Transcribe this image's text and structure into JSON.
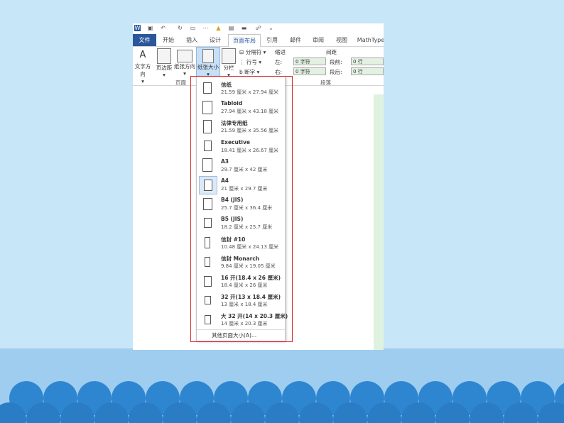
{
  "qat": {
    "icons": [
      "word-logo-icon",
      "save-icon",
      "undo-icon",
      "redo-icon",
      "new-doc-icon",
      "customize-icon",
      "warning-icon",
      "picture-icon",
      "equation-icon",
      "org-chart-icon",
      "more-icon"
    ]
  },
  "tabs": [
    {
      "label": "文件"
    },
    {
      "label": "开始"
    },
    {
      "label": "插入"
    },
    {
      "label": "设计"
    },
    {
      "label": "页面布局"
    },
    {
      "label": "引用"
    },
    {
      "label": "邮件"
    },
    {
      "label": "审阅"
    },
    {
      "label": "视图"
    },
    {
      "label": "MathType"
    }
  ],
  "ribbon": {
    "text_direction": "文字方向",
    "margins": "页边距",
    "orientation": "纸张方向",
    "size": "纸张大小",
    "columns": "分栏",
    "breaks": "分隔符",
    "line_numbers": "行号",
    "hyphenation": "断字",
    "indent_title": "缩进",
    "spacing_title": "间距",
    "indent_left_label": "左:",
    "indent_left_value": "0 字符",
    "indent_right_label": "右:",
    "indent_right_value": "0 字符",
    "spacing_before_label": "段前:",
    "spacing_before_value": "0 行",
    "spacing_after_label": "段后:",
    "spacing_after_value": "0 行",
    "group_page_setup": "页面",
    "group_paragraph": "段落"
  },
  "dropdown": {
    "items": [
      {
        "name": "信纸",
        "dims": "21.59 厘米 x 27.94 厘米"
      },
      {
        "name": "Tabloid",
        "dims": "27.94 厘米 x 43.18 厘米"
      },
      {
        "name": "法律专用纸",
        "dims": "21.59 厘米 x 35.56 厘米"
      },
      {
        "name": "Executive",
        "dims": "18.41 厘米 x 26.67 厘米"
      },
      {
        "name": "A3",
        "dims": "29.7 厘米 x 42 厘米"
      },
      {
        "name": "A4",
        "dims": "21 厘米 x 29.7 厘米"
      },
      {
        "name": "B4 (JIS)",
        "dims": "25.7 厘米 x 36.4 厘米"
      },
      {
        "name": "B5 (JIS)",
        "dims": "18.2 厘米 x 25.7 厘米"
      },
      {
        "name": "信封 #10",
        "dims": "10.48 厘米 x 24.13 厘米"
      },
      {
        "name": "信封 Monarch",
        "dims": "9.84 厘米 x 19.05 厘米"
      },
      {
        "name": "16 开(18.4 x 26 厘米)",
        "dims": "18.4 厘米 x 26 厘米"
      },
      {
        "name": "32 开(13 x 18.4 厘米)",
        "dims": "13 厘米 x 18.4 厘米"
      },
      {
        "name": "大 32 开(14 x 20.3 厘米)",
        "dims": "14 厘米 x 20.3 厘米"
      }
    ],
    "selected": "A4",
    "more": "其他页面大小(A)..."
  },
  "colors": {
    "file_tab": "#2b579a",
    "highlight": "#d9252b",
    "background": "#c7e6f8",
    "waves": "#2f86d0"
  }
}
